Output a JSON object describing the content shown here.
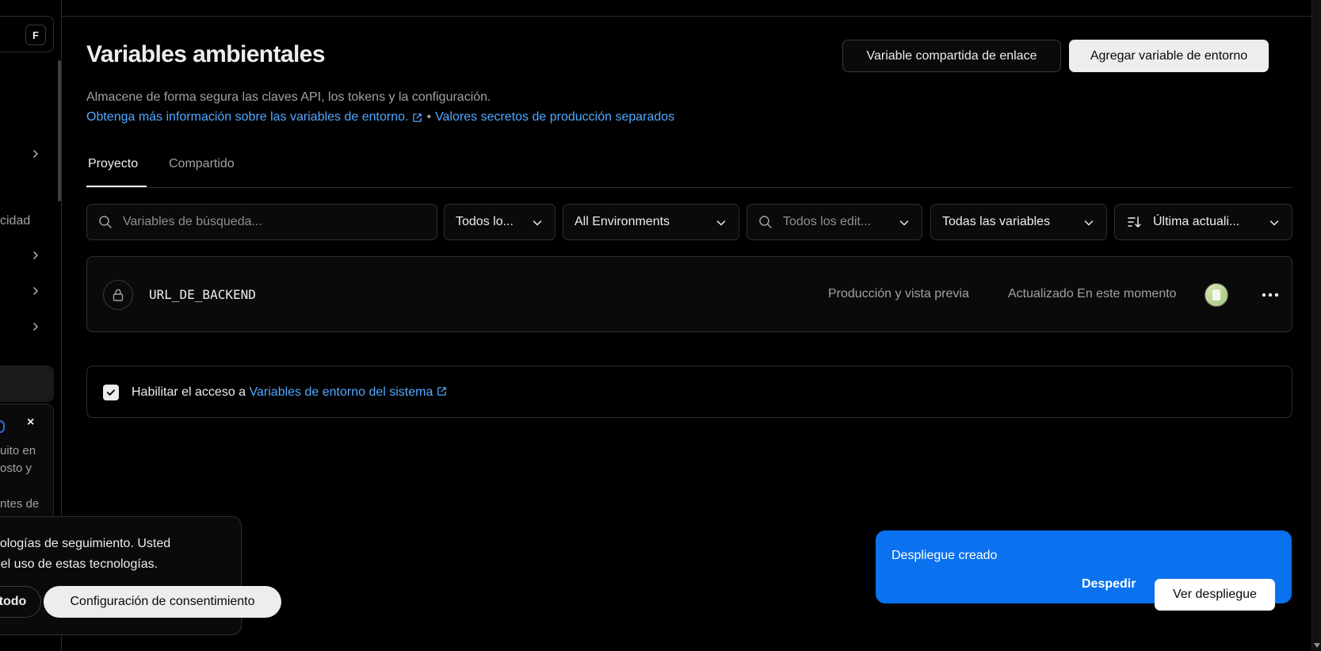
{
  "sidebar": {
    "kbd_shortcut": "F",
    "partial_label": "cidad",
    "card_lines": [
      "uito en",
      "osto y",
      "ntes de"
    ]
  },
  "header": {
    "title": "Variables ambientales",
    "link_shared_button": "Variable compartida de enlace",
    "add_env_button": "Agregar variable de entorno"
  },
  "description": {
    "text": "Almacene de forma segura las claves API, los tokens y la configuración.",
    "learn_more_link": "Obtenga más información sobre las variables de entorno.",
    "separator": "•",
    "secrets_link": "Valores secretos de producción separados"
  },
  "tabs": [
    {
      "label": "Proyecto",
      "active": true
    },
    {
      "label": "Compartido",
      "active": false
    }
  ],
  "filters": {
    "search_placeholder": "Variables de búsqueda...",
    "scope_select": "Todos lo...",
    "environment_select": "All Environments",
    "editor_placeholder": "Todos los edit...",
    "type_select": "Todas las variables",
    "sort_select": "Última actuali..."
  },
  "variables": [
    {
      "name": "URL_DE_BACKEND",
      "environments": "Producción y vista previa",
      "updated": "Actualizado En este momento",
      "avatar": "user-avatar"
    }
  ],
  "system_access": {
    "checked": true,
    "prefix": "Habilitar el acceso a",
    "link": "Variables de entorno del sistema"
  },
  "cookie_banner": {
    "line1": "nologías de seguimiento. Usted",
    "line2": "r el uso de estas tecnologías.",
    "accept_all": "todo",
    "consent_settings": "Configuración de consentimiento"
  },
  "toast": {
    "title": "Despliegue creado",
    "dismiss": "Despedir",
    "view": "Ver despliegue",
    "color": "#0a72ef"
  }
}
